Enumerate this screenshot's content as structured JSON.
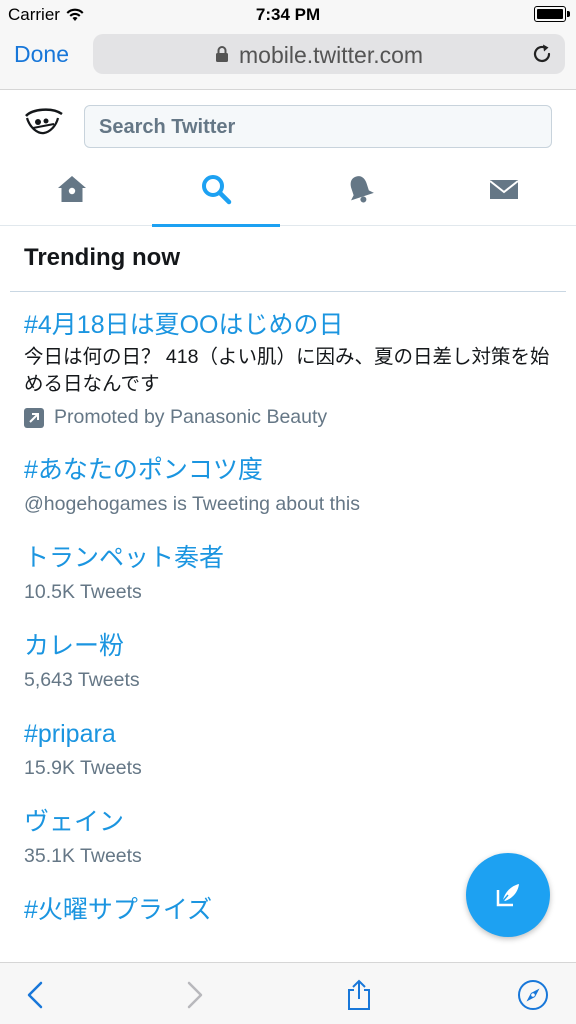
{
  "status_bar": {
    "carrier": "Carrier",
    "time": "7:34 PM"
  },
  "browser": {
    "done_label": "Done",
    "url": "mobile.twitter.com"
  },
  "twitter": {
    "search_placeholder": "Search Twitter",
    "tabs": [
      "home",
      "explore",
      "notifications",
      "messages"
    ],
    "active_tab": "explore"
  },
  "trends": {
    "title": "Trending now",
    "items": [
      {
        "name": "#4月18日は夏OOはじめの日",
        "description": "今日は何の日？ 418（よい肌）に因み、夏の日差し対策を始める日なんです",
        "promoted": "Promoted by Panasonic Beauty"
      },
      {
        "name": "#あなたのポンコツ度",
        "meta": "@hogehogames is Tweeting about this"
      },
      {
        "name": "トランペット奏者",
        "meta": "10.5K Tweets"
      },
      {
        "name": "カレー粉",
        "meta": "5,643 Tweets"
      },
      {
        "name": "#pripara",
        "meta": "15.9K Tweets"
      },
      {
        "name": "ヴェイン",
        "meta": "35.1K Tweets"
      },
      {
        "name": "#火曜サプライズ"
      }
    ]
  },
  "colors": {
    "accent": "#1da1f2",
    "link": "#1b95e0",
    "safari_blue": "#1877d9",
    "secondary_text": "#657786"
  }
}
